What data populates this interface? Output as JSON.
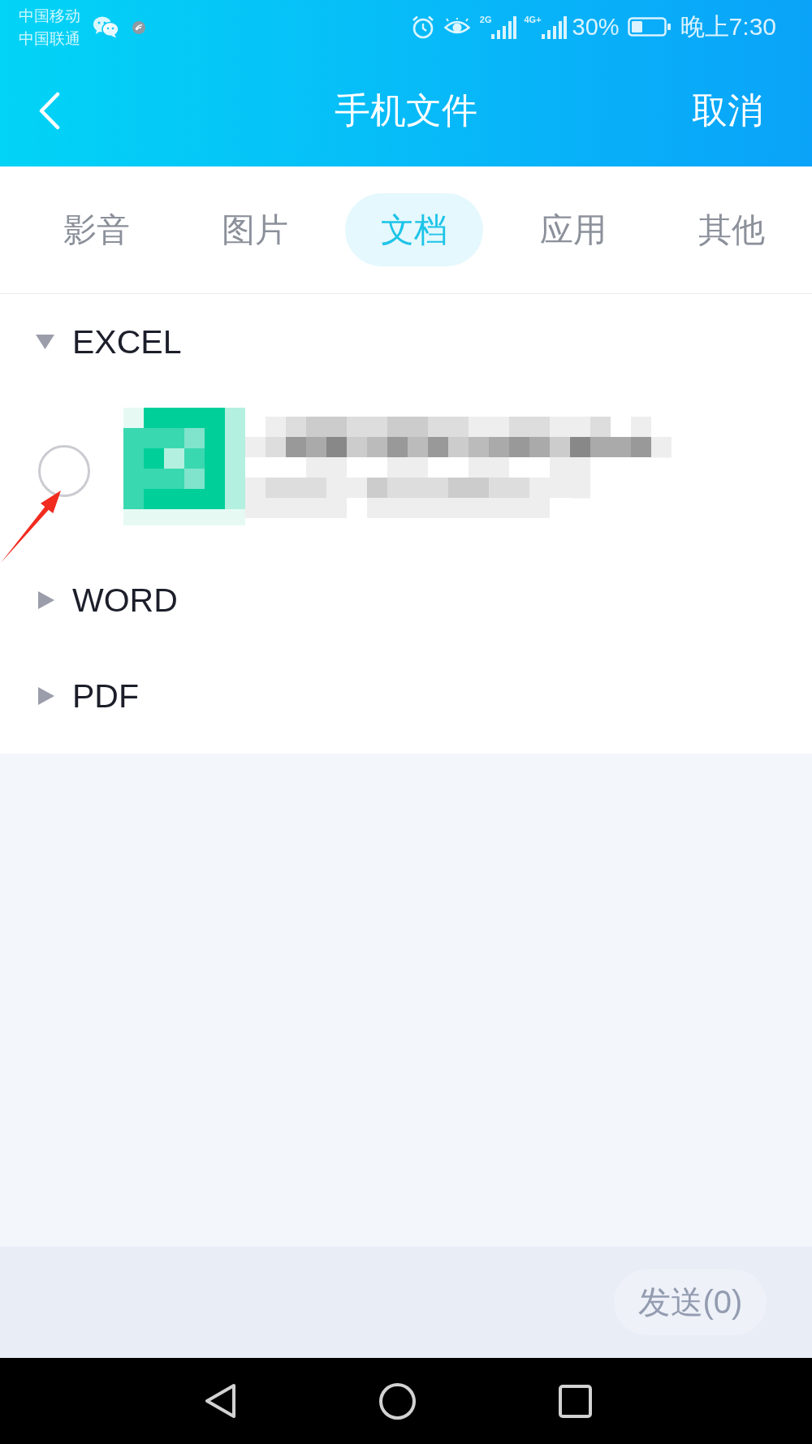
{
  "status_bar": {
    "carriers": [
      "中国移动",
      "中国联通"
    ],
    "network_labels": [
      "2G",
      "4G+"
    ],
    "battery": "30%",
    "time": "晚上7:30"
  },
  "header": {
    "title": "手机文件",
    "cancel": "取消"
  },
  "tabs": [
    {
      "label": "影音",
      "selected": false
    },
    {
      "label": "图片",
      "selected": false
    },
    {
      "label": "文档",
      "selected": true
    },
    {
      "label": "应用",
      "selected": false
    },
    {
      "label": "其他",
      "selected": false
    }
  ],
  "sections": [
    {
      "label": "EXCEL",
      "expanded": true,
      "files": [
        {
          "selected": false
        }
      ]
    },
    {
      "label": "WORD",
      "expanded": false
    },
    {
      "label": "PDF",
      "expanded": false
    }
  ],
  "footer": {
    "send_button": {
      "label": "发送(0)",
      "disabled": true
    }
  }
}
